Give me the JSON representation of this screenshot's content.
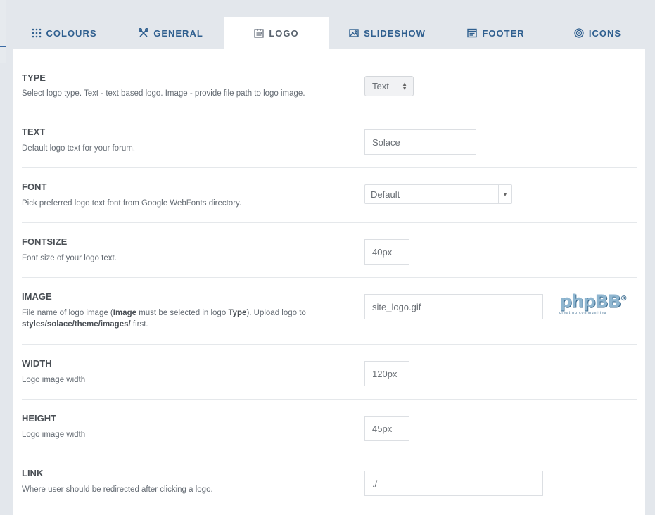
{
  "tabs": [
    {
      "label": "COLOURS",
      "icon": "grid-dots-icon",
      "active": false
    },
    {
      "label": "GENERAL",
      "icon": "tools-icon",
      "active": false
    },
    {
      "label": "LOGO",
      "icon": "id-card-icon",
      "active": true
    },
    {
      "label": "SLIDESHOW",
      "icon": "image-icon",
      "active": false
    },
    {
      "label": "FOOTER",
      "icon": "window-icon",
      "active": false
    },
    {
      "label": "ICONS",
      "icon": "target-icon",
      "active": false
    }
  ],
  "colors": {
    "accent": "#2f5f8f",
    "active_tab_text": "#5b6570",
    "background": "#e3e7ec"
  },
  "settings": {
    "type": {
      "label": "TYPE",
      "desc": "Select logo type. Text - text based logo. Image - provide file path to logo image.",
      "value": "Text"
    },
    "text": {
      "label": "TEXT",
      "desc": "Default logo text for your forum.",
      "value": "Solace"
    },
    "font": {
      "label": "FONT",
      "desc": "Pick preferred logo text font from Google WebFonts directory.",
      "value": "Default"
    },
    "fontsize": {
      "label": "FONTSIZE",
      "desc": "Font size of your logo text.",
      "value": "40px"
    },
    "image": {
      "label": "IMAGE",
      "desc_1": "File name of logo image (",
      "desc_bold_1": "Image",
      "desc_2": " must be selected in logo ",
      "desc_bold_2": "Type",
      "desc_3": "). Upload logo to",
      "desc_bold_3": "styles/solace/theme/images/",
      "desc_4": " first.",
      "value": "site_logo.gif",
      "preview_text": "phpBB",
      "preview_reg": "®",
      "preview_tagline": "creating communities"
    },
    "width": {
      "label": "WIDTH",
      "desc": "Logo image width",
      "value": "120px"
    },
    "height": {
      "label": "HEIGHT",
      "desc": "Logo image width",
      "value": "45px"
    },
    "link": {
      "label": "LINK",
      "desc": "Where user should be redirected after clicking a logo.",
      "value": "./"
    }
  }
}
